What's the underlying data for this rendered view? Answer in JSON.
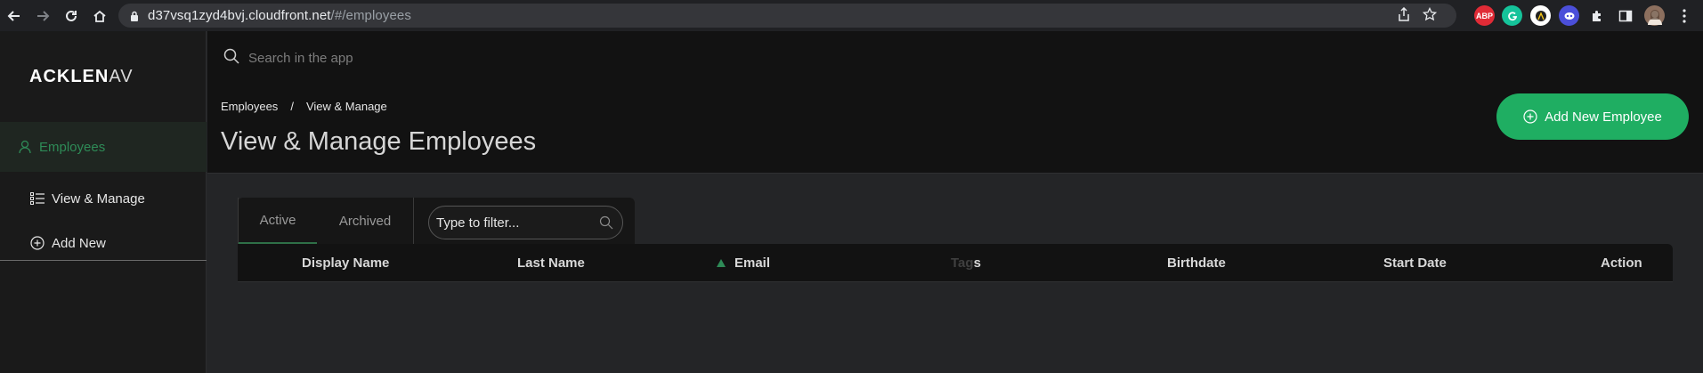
{
  "browser": {
    "url_host": "d37vsq1zyd4bvj.cloudfront.net",
    "url_path": "/#/employees",
    "extension_abp": "ABP"
  },
  "sidebar": {
    "logo_bold": "ACKLEN",
    "logo_thin": "AV",
    "items": [
      {
        "label": "Employees"
      },
      {
        "label": "View & Manage"
      },
      {
        "label": "Add New"
      }
    ]
  },
  "header": {
    "search_placeholder": "Search in the app",
    "breadcrumb": [
      "Employees",
      "/",
      "View & Manage"
    ],
    "title": "View & Manage Employees",
    "add_button_label": "Add New Employee"
  },
  "content": {
    "tabs": [
      {
        "label": "Active",
        "active": true
      },
      {
        "label": "Archived",
        "active": false
      }
    ],
    "filter_placeholder": "Type to filter...",
    "columns": [
      "Display Name",
      "Last Name",
      "Email",
      "Tag",
      "s",
      "Birthdate",
      "Start Date",
      "Action"
    ]
  },
  "colors": {
    "accent": "#1fae62",
    "active_text": "#2e8b57"
  }
}
